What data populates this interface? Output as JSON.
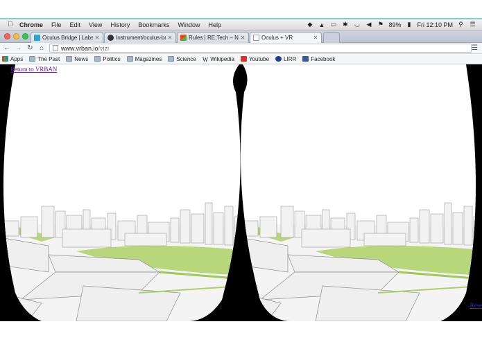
{
  "menubar": {
    "app_name": "Chrome",
    "items": [
      "File",
      "Edit",
      "View",
      "History",
      "Bookmarks",
      "Window",
      "Help"
    ],
    "battery": "89%",
    "clock": "Fri 12:10 PM"
  },
  "tabs": [
    {
      "label": "Oculus Bridge | Labs | Inst",
      "favicon_color": "#2aa7c9"
    },
    {
      "label": "Instrument/oculus-bridge",
      "favicon_color": "#333333"
    },
    {
      "label": "Rules | RE:Tech – NYC Rea",
      "favicon_color": "#e64a19"
    },
    {
      "label": "Oculus + VR",
      "favicon_color": "#ffffff",
      "active": true
    }
  ],
  "address": {
    "host": "www.vrban.io",
    "path": "/vizi"
  },
  "bookmarks": [
    {
      "label": "Apps",
      "icon": "apps-grid-icon"
    },
    {
      "label": "The Past",
      "icon": "folder-icon"
    },
    {
      "label": "News",
      "icon": "folder-icon"
    },
    {
      "label": "Politics",
      "icon": "folder-icon"
    },
    {
      "label": "Magazines",
      "icon": "folder-icon"
    },
    {
      "label": "Science",
      "icon": "folder-icon"
    },
    {
      "label": "Wikipedia",
      "icon": "wikipedia-icon"
    },
    {
      "label": "Youtube",
      "icon": "youtube-icon"
    },
    {
      "label": "LIRR",
      "icon": "lirr-icon"
    },
    {
      "label": "Facebook",
      "icon": "facebook-icon"
    }
  ],
  "page": {
    "return_link": "Return to VRBAN",
    "right_link": "Rese"
  },
  "colors": {
    "grass": "#b7d77a",
    "building": "#f2f2f2",
    "background": "#000000"
  }
}
